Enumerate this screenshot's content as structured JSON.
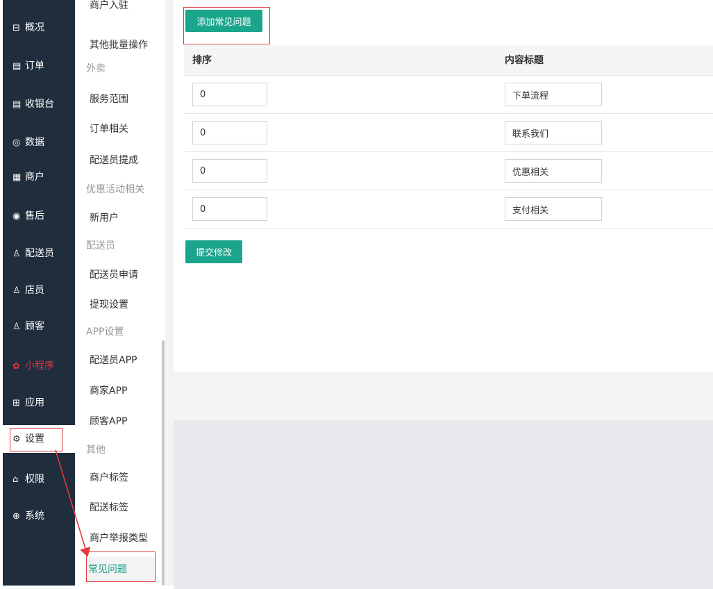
{
  "sidebar": {
    "items": [
      {
        "icon": "dashboard-icon",
        "glyph": "⊟",
        "label": "概况"
      },
      {
        "icon": "order-icon",
        "glyph": "▤",
        "label": "订单"
      },
      {
        "icon": "cashier-icon",
        "glyph": "▤",
        "label": "收银台"
      },
      {
        "icon": "data-icon",
        "glyph": "◎",
        "label": "数据"
      },
      {
        "icon": "store-icon",
        "glyph": "▦",
        "label": "商户"
      },
      {
        "icon": "after-sales-icon",
        "glyph": "◉",
        "label": "售后"
      },
      {
        "icon": "courier-icon",
        "glyph": "♙",
        "label": "配送员"
      },
      {
        "icon": "clerk-icon",
        "glyph": "♙",
        "label": "店员"
      },
      {
        "icon": "customer-icon",
        "glyph": "♙",
        "label": "顾客"
      },
      {
        "icon": "mini-program-icon",
        "glyph": "✿",
        "label": "小程序"
      },
      {
        "icon": "apps-icon",
        "glyph": "⊞",
        "label": "应用"
      },
      {
        "icon": "gear-icon",
        "glyph": "⚙",
        "label": "设置"
      },
      {
        "icon": "permission-icon",
        "glyph": "⌂",
        "label": "权限"
      },
      {
        "icon": "system-icon",
        "glyph": "⊕",
        "label": "系统"
      }
    ],
    "active": "设置",
    "highlight_color": "#e4393c"
  },
  "submenu": {
    "entries": [
      {
        "type": "item",
        "label": "商户入驻"
      },
      {
        "type": "item",
        "label": "其他批量操作"
      },
      {
        "type": "group",
        "label": "外卖"
      },
      {
        "type": "item",
        "label": "服务范围"
      },
      {
        "type": "item",
        "label": "订单相关"
      },
      {
        "type": "item",
        "label": "配送员提成"
      },
      {
        "type": "group",
        "label": "优惠活动相关"
      },
      {
        "type": "item",
        "label": "新用户"
      },
      {
        "type": "group",
        "label": "配送员"
      },
      {
        "type": "item",
        "label": "配送员申请"
      },
      {
        "type": "item",
        "label": "提现设置"
      },
      {
        "type": "group",
        "label": "APP设置"
      },
      {
        "type": "item",
        "label": "配送员APP"
      },
      {
        "type": "item",
        "label": "商家APP"
      },
      {
        "type": "item",
        "label": "顾客APP"
      },
      {
        "type": "group",
        "label": "其他"
      },
      {
        "type": "item",
        "label": "商户标签"
      },
      {
        "type": "item",
        "label": "配送标签"
      },
      {
        "type": "item",
        "label": "商户举报类型"
      },
      {
        "type": "item",
        "label": "常见问题"
      }
    ],
    "active": "常见问题",
    "accent_color": "#16a085"
  },
  "main": {
    "add_button_label": "添加常见问题",
    "columns": [
      "排序",
      "内容标题"
    ],
    "rows": [
      {
        "sort": "0",
        "title": "下单流程"
      },
      {
        "sort": "0",
        "title": "联系我们"
      },
      {
        "sort": "0",
        "title": "优惠相关"
      },
      {
        "sort": "0",
        "title": "支付相关"
      }
    ],
    "submit_button_label": "提交修改",
    "button_color": "#1aa58c"
  }
}
